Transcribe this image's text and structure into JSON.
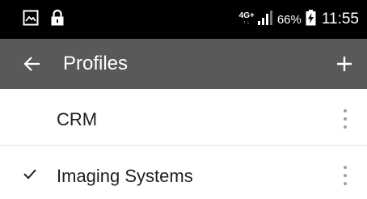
{
  "status_bar": {
    "left_icons": [
      "image-notification-icon",
      "lock-icon"
    ],
    "network_type": "4G+",
    "battery_percent": "66%",
    "time": "11:55"
  },
  "toolbar": {
    "title": "Profiles",
    "back_icon": "arrow-left-icon",
    "add_icon": "plus-icon"
  },
  "profiles": [
    {
      "name": "CRM",
      "selected": false
    },
    {
      "name": "Imaging Systems",
      "selected": true
    }
  ],
  "colors": {
    "status_bar_bg": "#000000",
    "toolbar_bg": "#595959",
    "list_bg": "#ffffff",
    "text_primary": "#1f1f1f",
    "divider": "#e6e6e6",
    "overflow_dots": "#9e9e9e"
  }
}
